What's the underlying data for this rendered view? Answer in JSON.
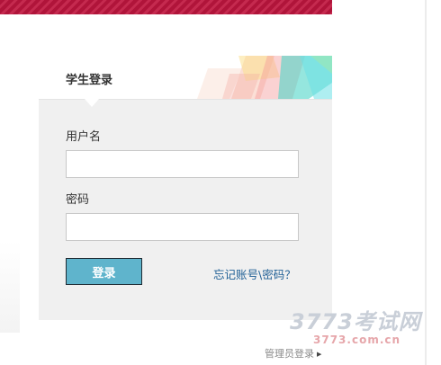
{
  "login": {
    "title": "学生登录",
    "username_label": "用户名",
    "username_value": "",
    "password_label": "密码",
    "password_value": "",
    "submit_label": "登录",
    "forgot_link": "忘记账号\\密码？"
  },
  "footer": {
    "admin_link": "管理员登录",
    "admin_arrow_icon": "triangle-right-icon"
  },
  "watermark": {
    "brand": "3773考试网",
    "url": "3773.com.cn"
  },
  "colors": {
    "banner": "#b0143a",
    "button": "#5fb4cc",
    "link": "#1f5f95",
    "panel_bg": "#f0f0f0"
  }
}
